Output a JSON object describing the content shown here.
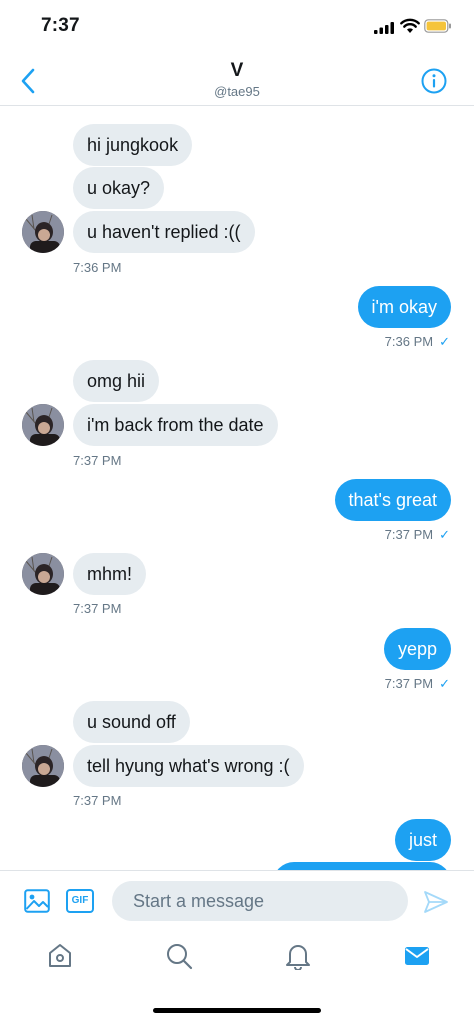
{
  "status_bar": {
    "time": "7:37",
    "battery_color": "#f5c43b"
  },
  "header": {
    "name": "V",
    "handle": "@tae95",
    "accent": "#1da1f2"
  },
  "messages": [
    {
      "text": "hi jungkook"
    },
    {
      "text": "u okay?"
    },
    {
      "text": "u haven't replied :(("
    },
    {
      "time": "7:36 PM"
    },
    {
      "text": "i'm okay"
    },
    {
      "time": "7:36 PM"
    },
    {
      "text": "omg hii"
    },
    {
      "text": "i'm back from the date"
    },
    {
      "time": "7:37 PM"
    },
    {
      "text": "that's great"
    },
    {
      "time": "7:37 PM"
    },
    {
      "text": "mhm!"
    },
    {
      "time": "7:37 PM"
    },
    {
      "text": "yepp"
    },
    {
      "time": "7:37 PM"
    },
    {
      "text": "u sound off"
    },
    {
      "text": "tell hyung what's wrong :("
    },
    {
      "time": "7:37 PM"
    },
    {
      "text": "just"
    }
  ],
  "composer": {
    "placeholder": "Start a message",
    "gif_label": "GIF"
  },
  "tabbar": {
    "icons": [
      "home-icon",
      "search-icon",
      "bell-icon",
      "mail-icon"
    ]
  },
  "colors": {
    "incoming_bubble": "#e6ecf0",
    "outgoing_bubble": "#1da1f2"
  }
}
